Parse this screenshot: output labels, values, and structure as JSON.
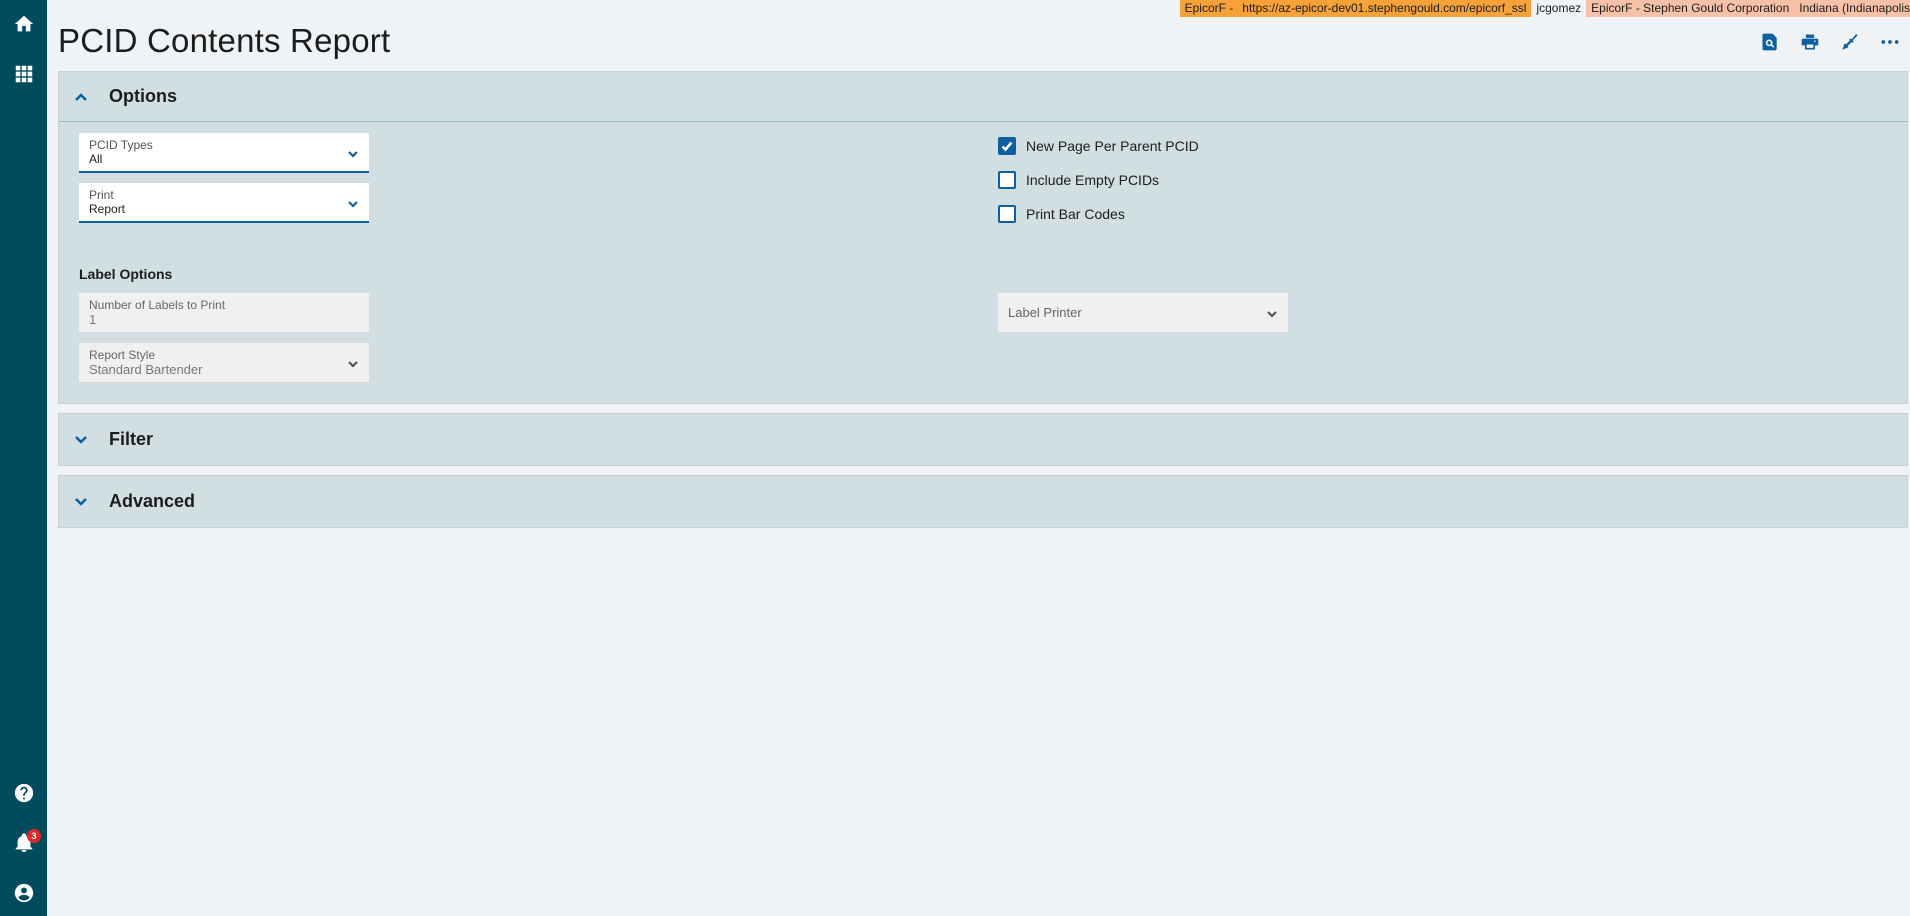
{
  "env": {
    "company": "EpicorF -",
    "url": "https://az-epicor-dev01.stephengould.com/epicorf_ssl",
    "user": "jcgomez",
    "org": "EpicorF - Stephen Gould Corporation",
    "site": "Indiana (Indianapolis"
  },
  "page": {
    "title": "PCID Contents Report"
  },
  "notifications": {
    "count": "3"
  },
  "options": {
    "title": "Options",
    "pcid_types": {
      "label": "PCID Types",
      "value": "All"
    },
    "print": {
      "label": "Print",
      "value": "Report"
    },
    "checkboxes": [
      {
        "label": "New Page Per Parent PCID",
        "checked": true
      },
      {
        "label": "Include Empty PCIDs",
        "checked": false
      },
      {
        "label": "Print Bar Codes",
        "checked": false
      }
    ],
    "label_options": {
      "title": "Label Options",
      "num_labels": {
        "label": "Number of Labels to Print",
        "value": "1"
      },
      "report_style": {
        "label": "Report Style",
        "value": "Standard Bartender"
      },
      "label_printer": {
        "placeholder": "Label Printer"
      }
    }
  },
  "filter": {
    "title": "Filter"
  },
  "advanced": {
    "title": "Advanced"
  },
  "colors": {
    "nav_bg": "#014b5f",
    "accent": "#0d5fa0",
    "panel_bg": "#d1dfe3",
    "env_company": "#f7a239",
    "env_org": "#f6c1a6"
  },
  "icons": {
    "nav": [
      "home-icon",
      "apps-grid-icon",
      "help-icon",
      "bell-icon",
      "user-icon"
    ],
    "toolbar": [
      "print-preview-icon",
      "print-icon",
      "clear-icon",
      "more-icon"
    ]
  }
}
